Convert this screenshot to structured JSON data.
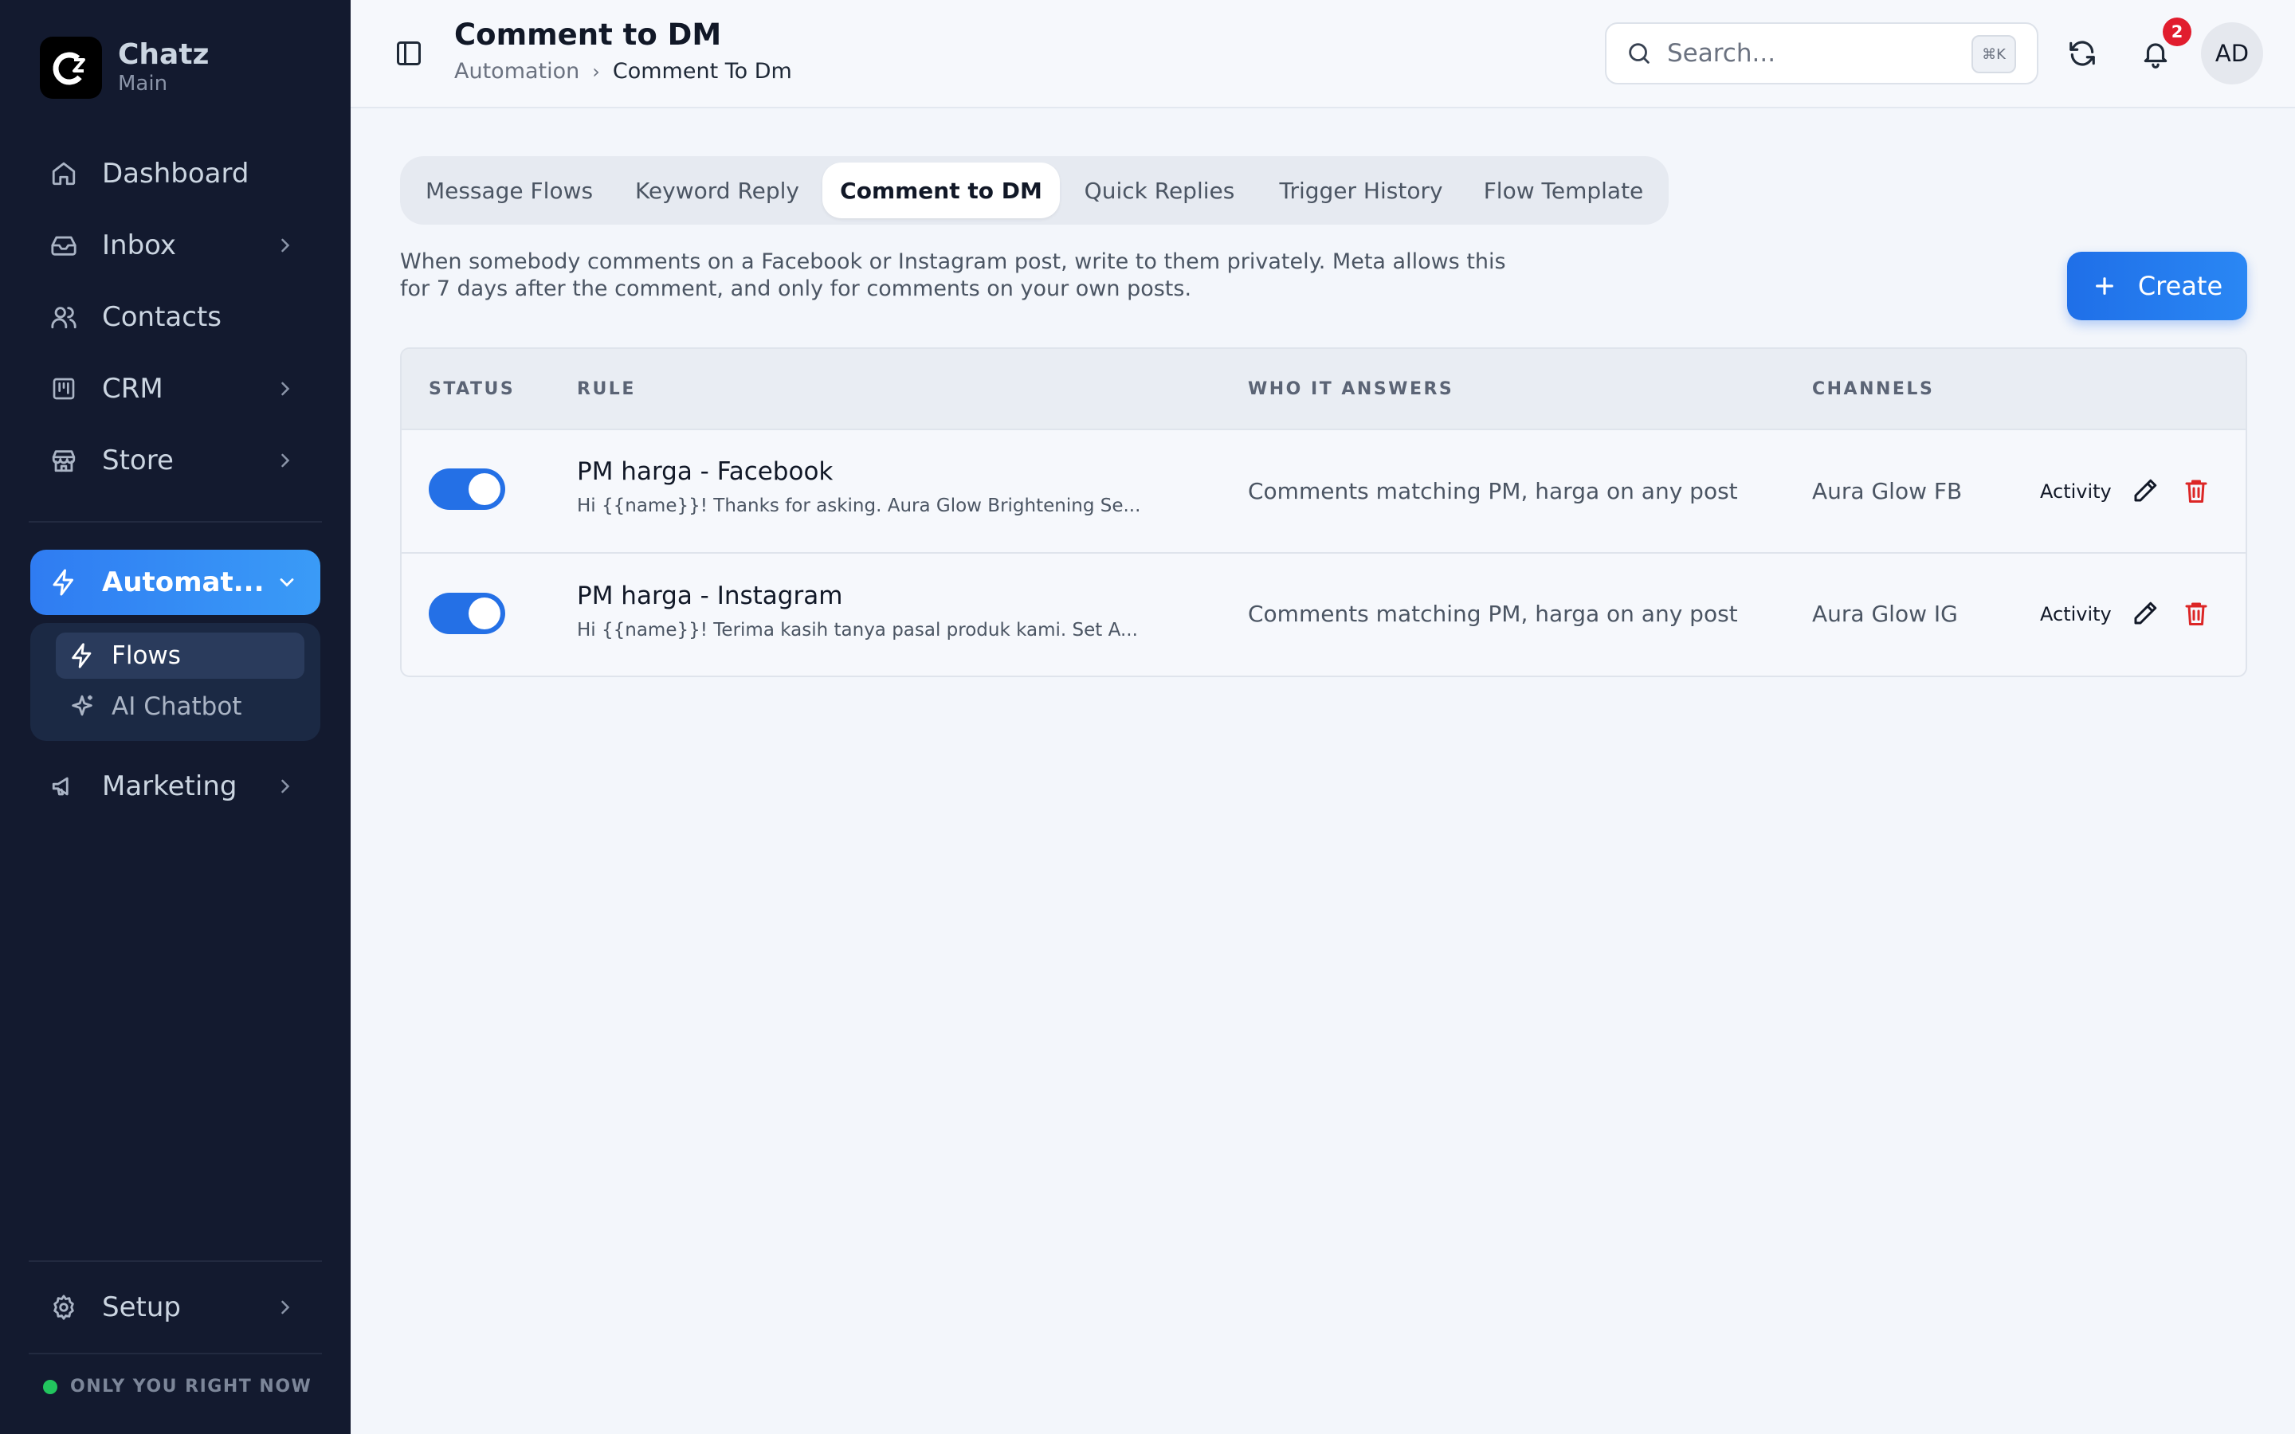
{
  "brand": {
    "name": "Chatz",
    "workspace": "Main"
  },
  "sidebar": {
    "items": [
      {
        "label": "Dashboard",
        "icon": "home-icon"
      },
      {
        "label": "Inbox",
        "icon": "inbox-icon"
      },
      {
        "label": "Contacts",
        "icon": "users-icon"
      },
      {
        "label": "CRM",
        "icon": "kanban-icon"
      },
      {
        "label": "Store",
        "icon": "store-icon"
      }
    ],
    "active": {
      "label": "Automat...",
      "icon": "zap-icon"
    },
    "subitems": [
      {
        "label": "Flows",
        "icon": "zap-icon"
      },
      {
        "label": "AI Chatbot",
        "icon": "sparkles-icon"
      }
    ],
    "after": {
      "label": "Marketing",
      "icon": "megaphone-icon"
    },
    "setup": {
      "label": "Setup",
      "icon": "gear-icon"
    },
    "status": "ONLY YOU RIGHT NOW"
  },
  "header": {
    "title": "Comment to DM",
    "breadcrumb": [
      "Automation",
      "Comment To Dm"
    ],
    "search_placeholder": "Search...",
    "shortcut": "⌘K",
    "notification_count": "2",
    "avatar_initials": "AD"
  },
  "tabs": [
    "Message Flows",
    "Keyword Reply",
    "Comment to DM",
    "Quick Replies",
    "Trigger History",
    "Flow Template"
  ],
  "active_tab": "Comment to DM",
  "description": "When somebody comments on a Facebook or Instagram post, write to them privately. Meta allows this for 7 days after the comment, and only for comments on your own posts.",
  "create_label": "Create",
  "table": {
    "columns": [
      "STATUS",
      "RULE",
      "WHO IT ANSWERS",
      "CHANNELS"
    ],
    "rows": [
      {
        "enabled": true,
        "rule": "PM harga - Facebook",
        "message": "Hi {{name}}! Thanks for asking. Aura Glow Brightening Se...",
        "who": "Comments matching PM, harga on any post",
        "channel": "Aura Glow FB",
        "activity": "Activity"
      },
      {
        "enabled": true,
        "rule": "PM harga - Instagram",
        "message": "Hi {{name}}! Terima kasih tanya pasal produk kami. Set A...",
        "who": "Comments matching PM, harga on any post",
        "channel": "Aura Glow IG",
        "activity": "Activity"
      }
    ]
  },
  "colors": {
    "sidebar_bg": "#131a2f",
    "accent": "#2470e6",
    "danger": "#dc2626",
    "online": "#22c55e"
  }
}
